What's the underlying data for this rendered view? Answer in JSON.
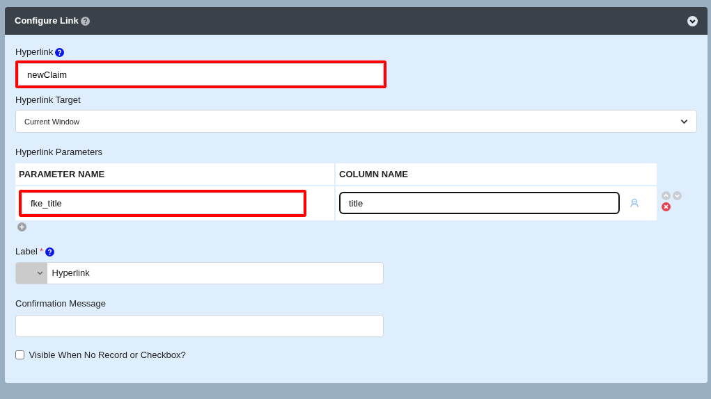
{
  "panel": {
    "title": "Configure Link",
    "expanded": true
  },
  "hyperlink": {
    "label": "Hyperlink",
    "value": "newClaim",
    "highlighted": true
  },
  "hyperlink_target": {
    "label": "Hyperlink Target",
    "value": "Current Window"
  },
  "parameters": {
    "label": "Hyperlink Parameters",
    "columns": [
      "PARAMETER NAME",
      "COLUMN NAME"
    ],
    "rows": [
      {
        "parameter_name": "fke_title",
        "parameter_highlighted": true,
        "column_name": "title",
        "column_focused": true
      }
    ]
  },
  "label_field": {
    "label": "Label",
    "required": true,
    "required_mark": "*",
    "value": "Hyperlink"
  },
  "confirmation": {
    "label": "Confirmation Message"
  },
  "visible_checkbox": {
    "label": "Visible When No Record or Checkbox?",
    "checked": false
  }
}
